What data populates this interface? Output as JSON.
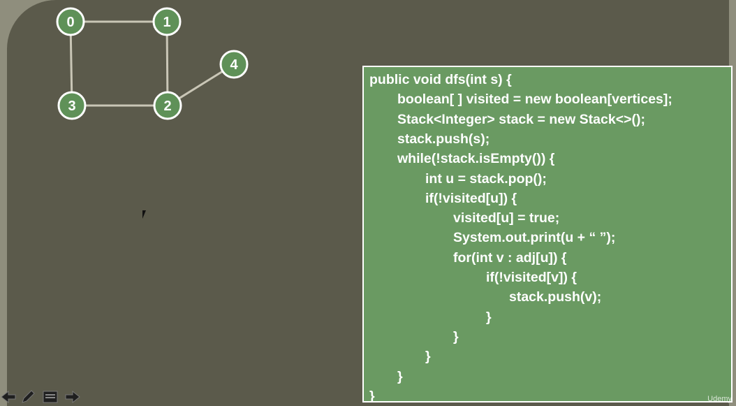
{
  "graph": {
    "nodes": [
      {
        "id": "0",
        "label": "0"
      },
      {
        "id": "1",
        "label": "1"
      },
      {
        "id": "2",
        "label": "2"
      },
      {
        "id": "3",
        "label": "3"
      },
      {
        "id": "4",
        "label": "4"
      }
    ],
    "edges": [
      [
        "0",
        "1"
      ],
      [
        "0",
        "3"
      ],
      [
        "1",
        "2"
      ],
      [
        "3",
        "2"
      ],
      [
        "2",
        "4"
      ]
    ]
  },
  "code": {
    "lines": [
      "public void dfs(int s) {",
      "boolean[ ] visited = new boolean[vertices];",
      "Stack<Integer> stack = new Stack<>();",
      "stack.push(s);",
      "while(!stack.isEmpty()) {",
      "int u = stack.pop();",
      "if(!visited[u]) {",
      "visited[u] = true;",
      "System.out.print(u + “ ”);",
      "for(int v : adj[u]) {",
      "if(!visited[v]) {",
      "stack.push(v);",
      "}",
      "}",
      "}",
      "}",
      "}"
    ]
  },
  "toolbar": {
    "buttons": [
      {
        "name": "previous-slide",
        "icon": "arrow-left-icon"
      },
      {
        "name": "pen-tool",
        "icon": "pencil-icon"
      },
      {
        "name": "slide-menu",
        "icon": "menu-icon"
      },
      {
        "name": "next-slide",
        "icon": "arrow-right-icon"
      }
    ]
  },
  "watermark": {
    "text": "Udemy"
  },
  "colors": {
    "slide_bg": "#5b5a4b",
    "node_fill": "#5f9158",
    "code_bg": "#6a9a62",
    "text": "#ffffff"
  }
}
